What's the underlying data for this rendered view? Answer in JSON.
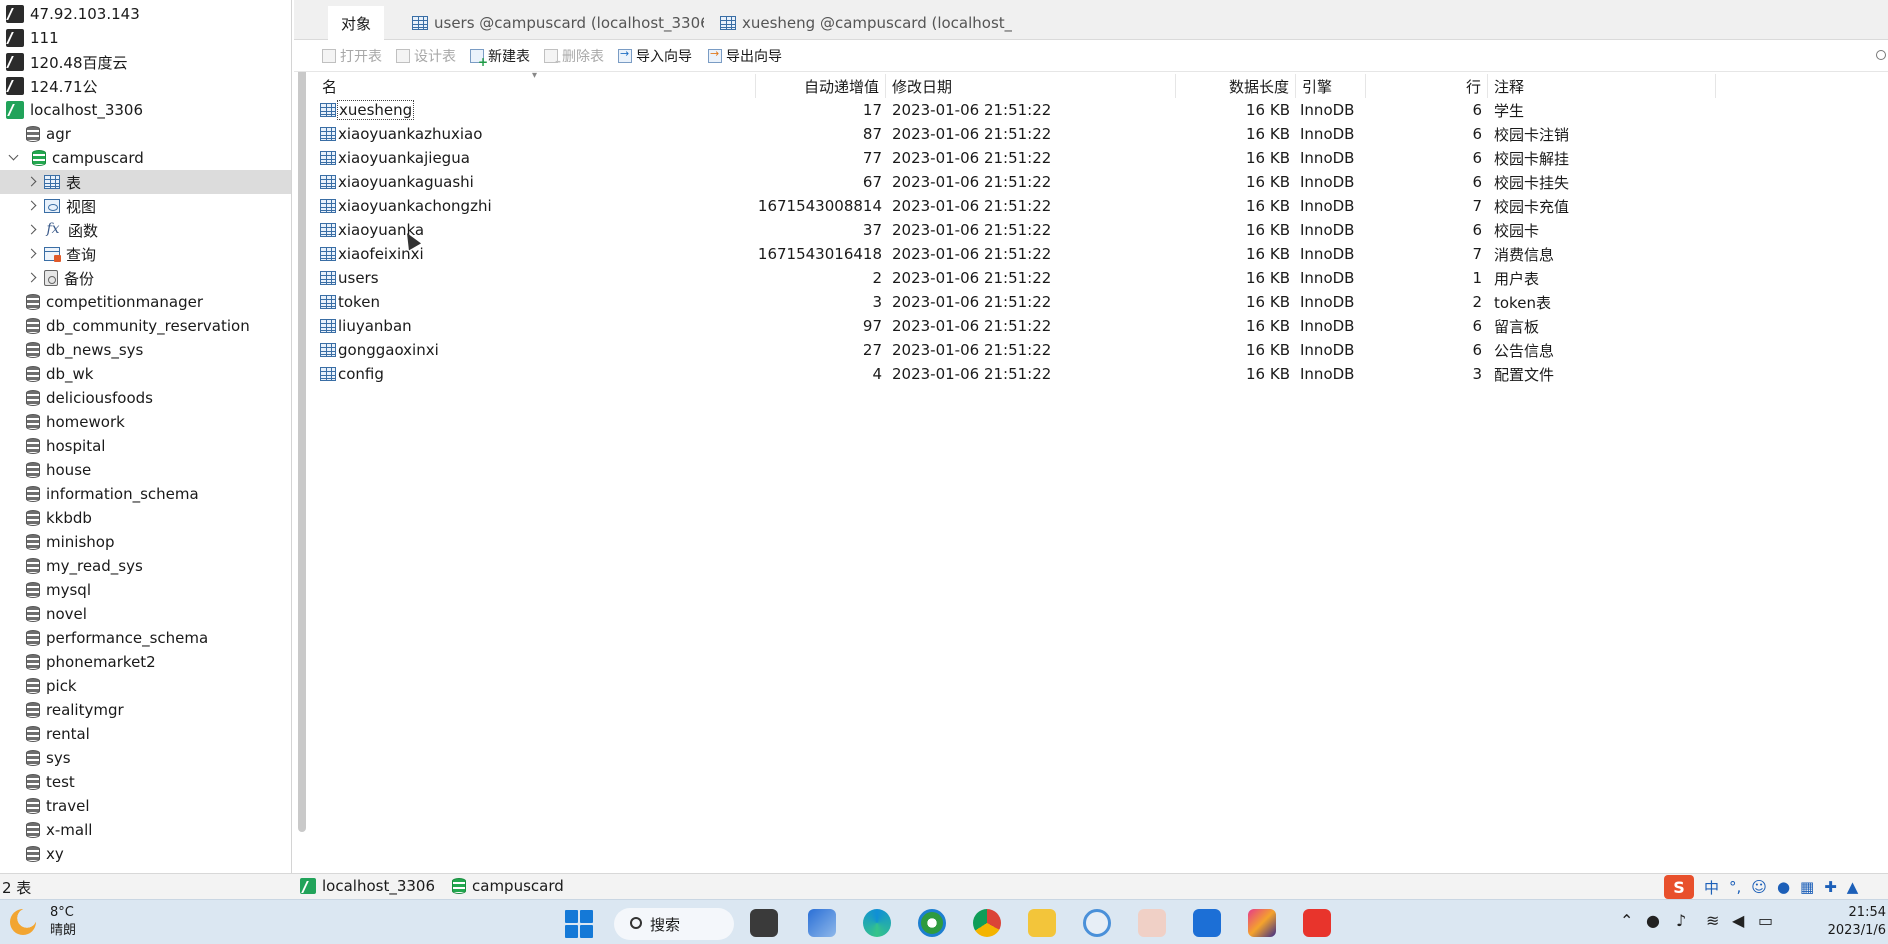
{
  "sidebar": {
    "connections_top": [
      {
        "label": "47.92.103.143"
      },
      {
        "label": "111"
      },
      {
        "label": "120.48百度云"
      },
      {
        "label": "124.71公"
      }
    ],
    "active_connection": {
      "label": "localhost_3306"
    },
    "db_agr": {
      "label": "agr"
    },
    "db_open": {
      "label": "campuscard"
    },
    "nodes": [
      {
        "label": "表"
      },
      {
        "label": "视图"
      },
      {
        "label": "函数"
      },
      {
        "label": "查询"
      },
      {
        "label": "备份"
      }
    ],
    "databases": [
      {
        "label": "competitionmanager"
      },
      {
        "label": "db_community_reservation"
      },
      {
        "label": "db_news_sys"
      },
      {
        "label": "db_wk"
      },
      {
        "label": "deliciousfoods"
      },
      {
        "label": "homework"
      },
      {
        "label": "hospital"
      },
      {
        "label": "house"
      },
      {
        "label": "information_schema"
      },
      {
        "label": "kkbdb"
      },
      {
        "label": "minishop"
      },
      {
        "label": "my_read_sys"
      },
      {
        "label": "mysql"
      },
      {
        "label": "novel"
      },
      {
        "label": "performance_schema"
      },
      {
        "label": "phonemarket2"
      },
      {
        "label": "pick"
      },
      {
        "label": "realitymgr"
      },
      {
        "label": "rental"
      },
      {
        "label": "sys"
      },
      {
        "label": "test"
      },
      {
        "label": "travel"
      },
      {
        "label": "x-mall"
      },
      {
        "label": "xy"
      }
    ]
  },
  "tabs": [
    {
      "label": "对象"
    },
    {
      "label": "users @campuscard (localhost_3306..."
    },
    {
      "label": "xuesheng @campuscard (localhost_..."
    }
  ],
  "toolbar": {
    "open_table": "打开表",
    "design_table": "设计表",
    "new_table": "新建表",
    "delete_table": "删除表",
    "import_wizard": "导入向导",
    "export_wizard": "导出向导"
  },
  "table": {
    "headers": {
      "name": "名",
      "auto_increment": "自动递增值",
      "modified": "修改日期",
      "data_length": "数据长度",
      "engine": "引擎",
      "rows": "行",
      "comment": "注释"
    },
    "rows": [
      {
        "name": "xuesheng",
        "auto_increment": "17",
        "modified": "2023-01-06 21:51:22",
        "data_length": "16 KB",
        "engine": "InnoDB",
        "rows": "6",
        "comment": "学生"
      },
      {
        "name": "xiaoyuankazhuxiao",
        "auto_increment": "87",
        "modified": "2023-01-06 21:51:22",
        "data_length": "16 KB",
        "engine": "InnoDB",
        "rows": "6",
        "comment": "校园卡注销"
      },
      {
        "name": "xiaoyuankajiegua",
        "auto_increment": "77",
        "modified": "2023-01-06 21:51:22",
        "data_length": "16 KB",
        "engine": "InnoDB",
        "rows": "6",
        "comment": "校园卡解挂"
      },
      {
        "name": "xiaoyuankaguashi",
        "auto_increment": "67",
        "modified": "2023-01-06 21:51:22",
        "data_length": "16 KB",
        "engine": "InnoDB",
        "rows": "6",
        "comment": "校园卡挂失"
      },
      {
        "name": "xiaoyuankachongzhi",
        "auto_increment": "1671543008814",
        "modified": "2023-01-06 21:51:22",
        "data_length": "16 KB",
        "engine": "InnoDB",
        "rows": "7",
        "comment": "校园卡充值"
      },
      {
        "name": "xiaoyuanka",
        "auto_increment": "37",
        "modified": "2023-01-06 21:51:22",
        "data_length": "16 KB",
        "engine": "InnoDB",
        "rows": "6",
        "comment": "校园卡"
      },
      {
        "name": "xiaofeixinxi",
        "auto_increment": "1671543016418",
        "modified": "2023-01-06 21:51:22",
        "data_length": "16 KB",
        "engine": "InnoDB",
        "rows": "7",
        "comment": "消费信息"
      },
      {
        "name": "users",
        "auto_increment": "2",
        "modified": "2023-01-06 21:51:22",
        "data_length": "16 KB",
        "engine": "InnoDB",
        "rows": "1",
        "comment": "用户表"
      },
      {
        "name": "token",
        "auto_increment": "3",
        "modified": "2023-01-06 21:51:22",
        "data_length": "16 KB",
        "engine": "InnoDB",
        "rows": "2",
        "comment": "token表"
      },
      {
        "name": "liuyanban",
        "auto_increment": "97",
        "modified": "2023-01-06 21:51:22",
        "data_length": "16 KB",
        "engine": "InnoDB",
        "rows": "6",
        "comment": "留言板"
      },
      {
        "name": "gonggaoxinxi",
        "auto_increment": "27",
        "modified": "2023-01-06 21:51:22",
        "data_length": "16 KB",
        "engine": "InnoDB",
        "rows": "6",
        "comment": "公告信息"
      },
      {
        "name": "config",
        "auto_increment": "4",
        "modified": "2023-01-06 21:51:22",
        "data_length": "16 KB",
        "engine": "InnoDB",
        "rows": "3",
        "comment": "配置文件"
      }
    ]
  },
  "statusbar": {
    "count": "2 表",
    "connection": "localhost_3306",
    "database": "campuscard"
  },
  "ime": {
    "logo": "S",
    "mode": "中",
    "punct": "°,"
  },
  "taskbar": {
    "temperature": "8°C",
    "condition": "晴朗",
    "search": "搜索",
    "time": "21:54",
    "date": "2023/1/6"
  },
  "colors": {
    "selection": "#dcdcdc",
    "connection_green": "#21a35a",
    "table_icon_blue": "#3a6ea5",
    "taskbar_bg": "#dbe7f2"
  }
}
